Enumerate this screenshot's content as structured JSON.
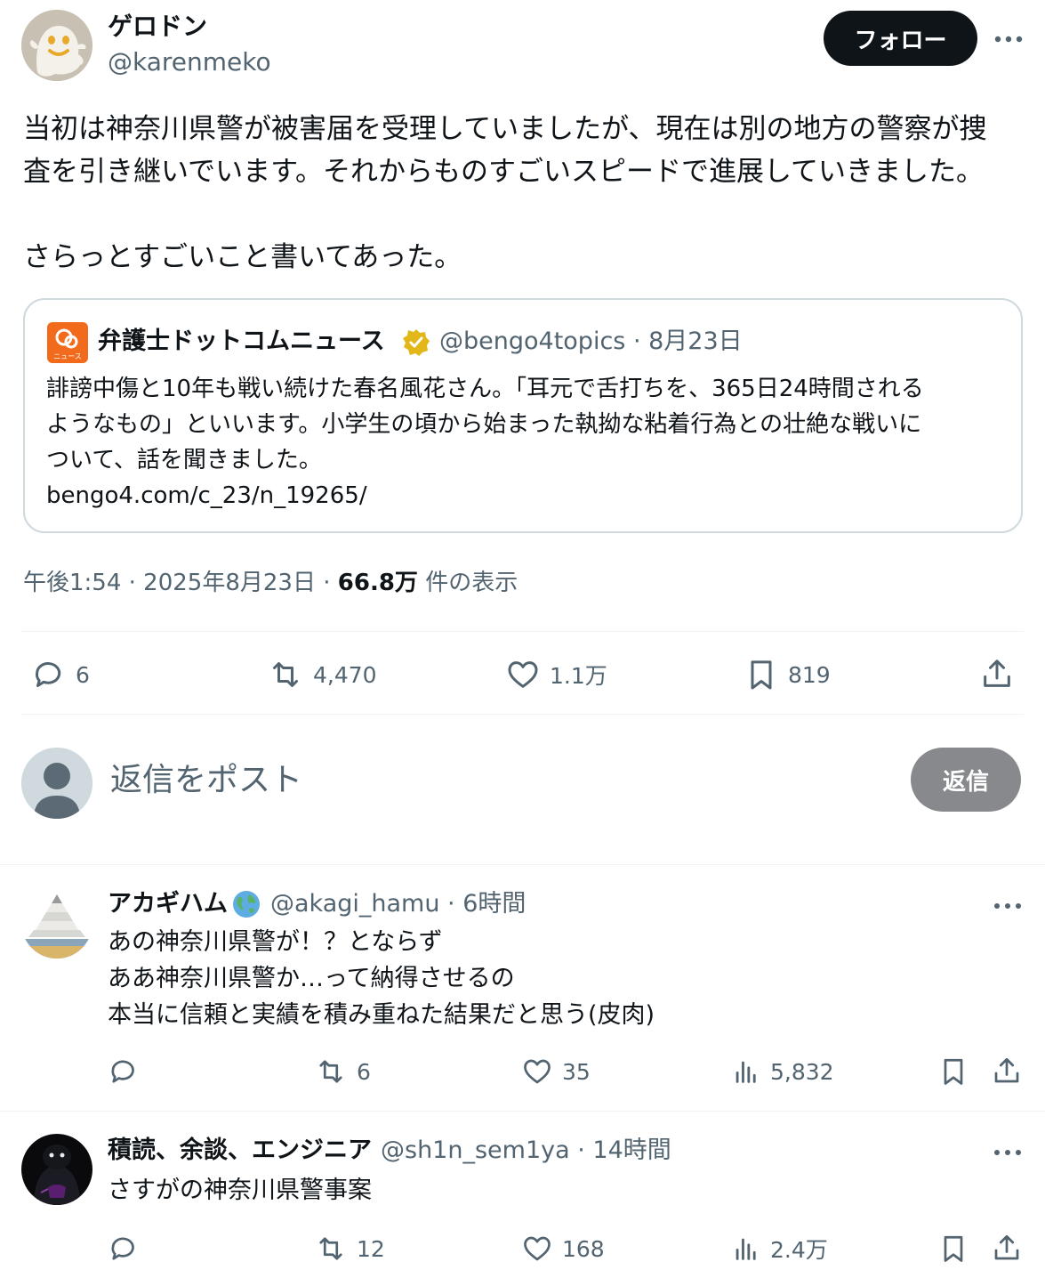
{
  "tweet": {
    "author_name": "ゲロドン",
    "author_handle": "@karenmeko",
    "follow_label": "フォロー",
    "text": "当初は神奈川県警が被害届を受理していましたが、現在は別の地方の警察が捜\n査を引き継いでいます。それからものすごいスピードで進展していきました。\n\nさらっとすごいこと書いてあった。",
    "quote": {
      "name": "弁護士ドットコムニュース",
      "handle_date": "@bengo4topics · 8月23日",
      "avatar_caption": "ニュース",
      "text": "誹謗中傷と10年も戦い続けた春名風花さん。「耳元で舌打ちを、365日24時間される\nようなもの」といいます。小学生の頃から始まった執拗な粘着行為との壮絶な戦いに\nついて、話を聞きました。\nbengo4.com/c_23/n_19265/"
    },
    "timestamp": "午後1:54 · 2025年8月23日 · ",
    "views_count": "66.8万",
    "views_label": " 件の表示",
    "stats": {
      "replies": "6",
      "reposts": "4,470",
      "likes": "1.1万",
      "bookmarks": "819"
    }
  },
  "composer": {
    "placeholder": "返信をポスト",
    "button_label": "返信"
  },
  "replies": [
    {
      "name": "アカギハム",
      "meta": "@akagi_hamu · 6時間",
      "text": "あの神奈川県警が！？とならず\nああ神奈川県警か…って納得させるの\n本当に信頼と実績を積み重ねた結果だと思う(皮肉)",
      "reposts": "6",
      "likes": "35",
      "views": "5,832"
    },
    {
      "name": "積読、余談、エンジニア",
      "meta": "@sh1n_sem1ya · 14時間",
      "text": "さすがの神奈川県警事案",
      "reposts": "12",
      "likes": "168",
      "views": "2.4万"
    }
  ],
  "icons": {
    "more": "more-icon",
    "reply": "reply-icon",
    "repost": "repost-icon",
    "like": "like-icon",
    "bookmark": "bookmark-icon",
    "share": "share-icon",
    "views": "views-icon",
    "verified": "verified-badge-icon",
    "globe": "globe-emoji-icon"
  },
  "colors": {
    "text": "#0f1419",
    "muted": "#536471",
    "border": "#cfd9de",
    "verified": "#e2b719",
    "quote_avatar": "#f26b1d"
  }
}
